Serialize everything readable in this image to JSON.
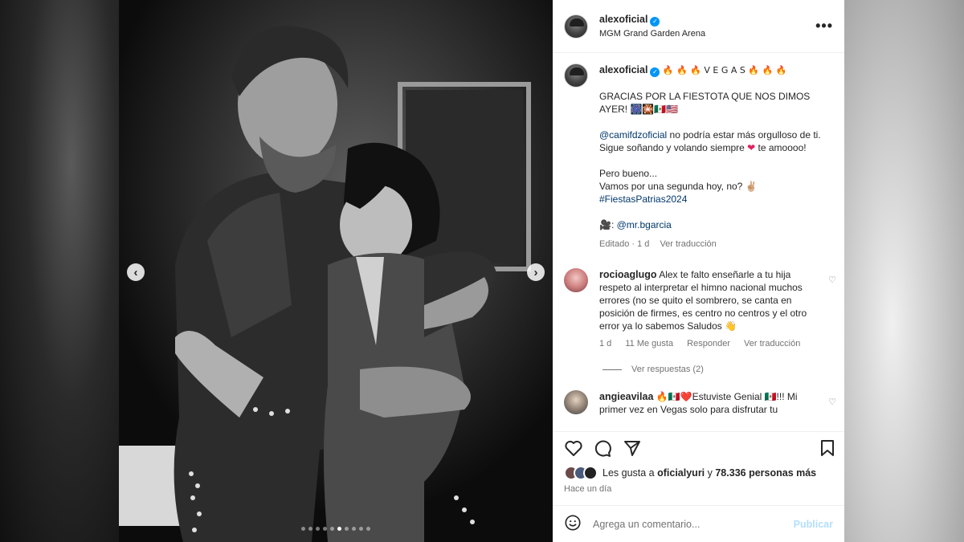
{
  "post": {
    "username": "alexoficial",
    "location": "MGM Grand Garden Arena",
    "more_label": "•••",
    "carousel": {
      "total_slides": 10,
      "current_slide": 6
    }
  },
  "caption": {
    "username": "alexoficial",
    "title_line": "🔥 🔥 🔥  V E G A S 🔥 🔥 🔥",
    "line1": "GRACIAS POR LA FIESTOTA QUE NOS DIMOS AYER! 🎆🎇🇲🇽🇺🇸",
    "mention": "@camifdzoficial",
    "line2_rest": " no podría estar más orgulloso de ti.",
    "line3": "Sigue soñando y volando siempre",
    "line3_end": " te amoooo!",
    "line4": "Pero bueno...",
    "line5": "Vamos por una segunda hoy, no? ✌🏼",
    "hashtag": "#FiestasPatrias2024",
    "credit_icon": "🎥:",
    "credit_user": "@mr.bgarcia",
    "edited": "Editado · 1 d",
    "translate": "Ver traducción"
  },
  "comments": [
    {
      "username": "rocioaglugo",
      "text": "Alex te falto enseñarle a tu hija respeto al interpretar el himno nacional muchos errores (no se quito el sombrero, se canta en posición de firmes, es centro no centros y el otro error ya lo sabemos Saludos 👋",
      "time": "1 d",
      "likes": "11 Me gusta",
      "reply": "Responder",
      "translate": "Ver traducción",
      "view_replies": "Ver respuestas (2)"
    },
    {
      "username": "angieavilaa",
      "text": "🔥🇲🇽❤️Estuviste Genial 🇲🇽!!! Mi primer vez en Vegas solo para disfrutar tu"
    }
  ],
  "likes": {
    "prefix": "Les gusta a ",
    "user": "oficialyuri",
    "suffix_join": " y ",
    "others": "78.336 personas más"
  },
  "time_ago": "Hace un día",
  "add_comment": {
    "placeholder": "Agrega un comentario...",
    "publish": "Publicar"
  },
  "colors": {
    "verified": "#0095f6",
    "link": "#00376b",
    "publish_disabled": "#b2dffc"
  }
}
